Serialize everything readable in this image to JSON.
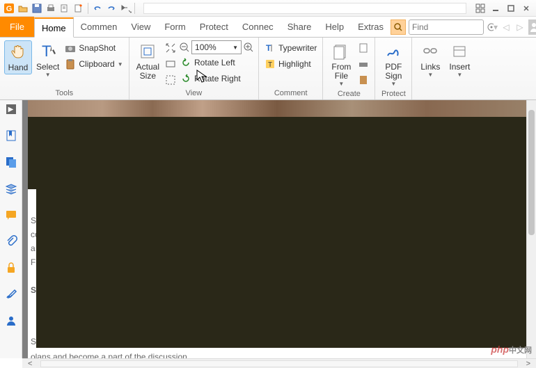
{
  "qat": {
    "icons": [
      "app",
      "open",
      "save",
      "print",
      "print-preview",
      "new",
      "undo",
      "redo",
      "share"
    ]
  },
  "window": {
    "title": ""
  },
  "menu": {
    "file": "File",
    "tabs": [
      "Home",
      "Commen",
      "View",
      "Form",
      "Protect",
      "Connec",
      "Share",
      "Help",
      "Extras"
    ],
    "active_idx": 0
  },
  "search": {
    "placeholder": "Find"
  },
  "ribbon": {
    "tools": {
      "hand": "Hand",
      "select": "Select",
      "snapshot": "SnapShot",
      "clipboard": "Clipboard",
      "label": "Tools"
    },
    "view": {
      "actual_size_1": "Actual",
      "actual_size_2": "Size",
      "zoom": "100%",
      "rotate_left": "Rotate Left",
      "rotate_right": "Rotate Right",
      "label": "View"
    },
    "comment": {
      "typewriter": "Typewriter",
      "highlight": "Highlight",
      "label": "Comment"
    },
    "create": {
      "from_file_1": "From",
      "from_file_2": "File",
      "label": "Create"
    },
    "protect": {
      "pdf_sign_1": "PDF",
      "pdf_sign_2": "Sign",
      "label": "Protect"
    },
    "links": {
      "label": "Links"
    },
    "insert": {
      "label": "Insert"
    }
  },
  "doc": {
    "lines": [
      "S",
      "co",
      "a",
      "Fa",
      "S",
      "S"
    ],
    "footer_text": "olans and become a part of the discussion"
  },
  "watermark": "php"
}
